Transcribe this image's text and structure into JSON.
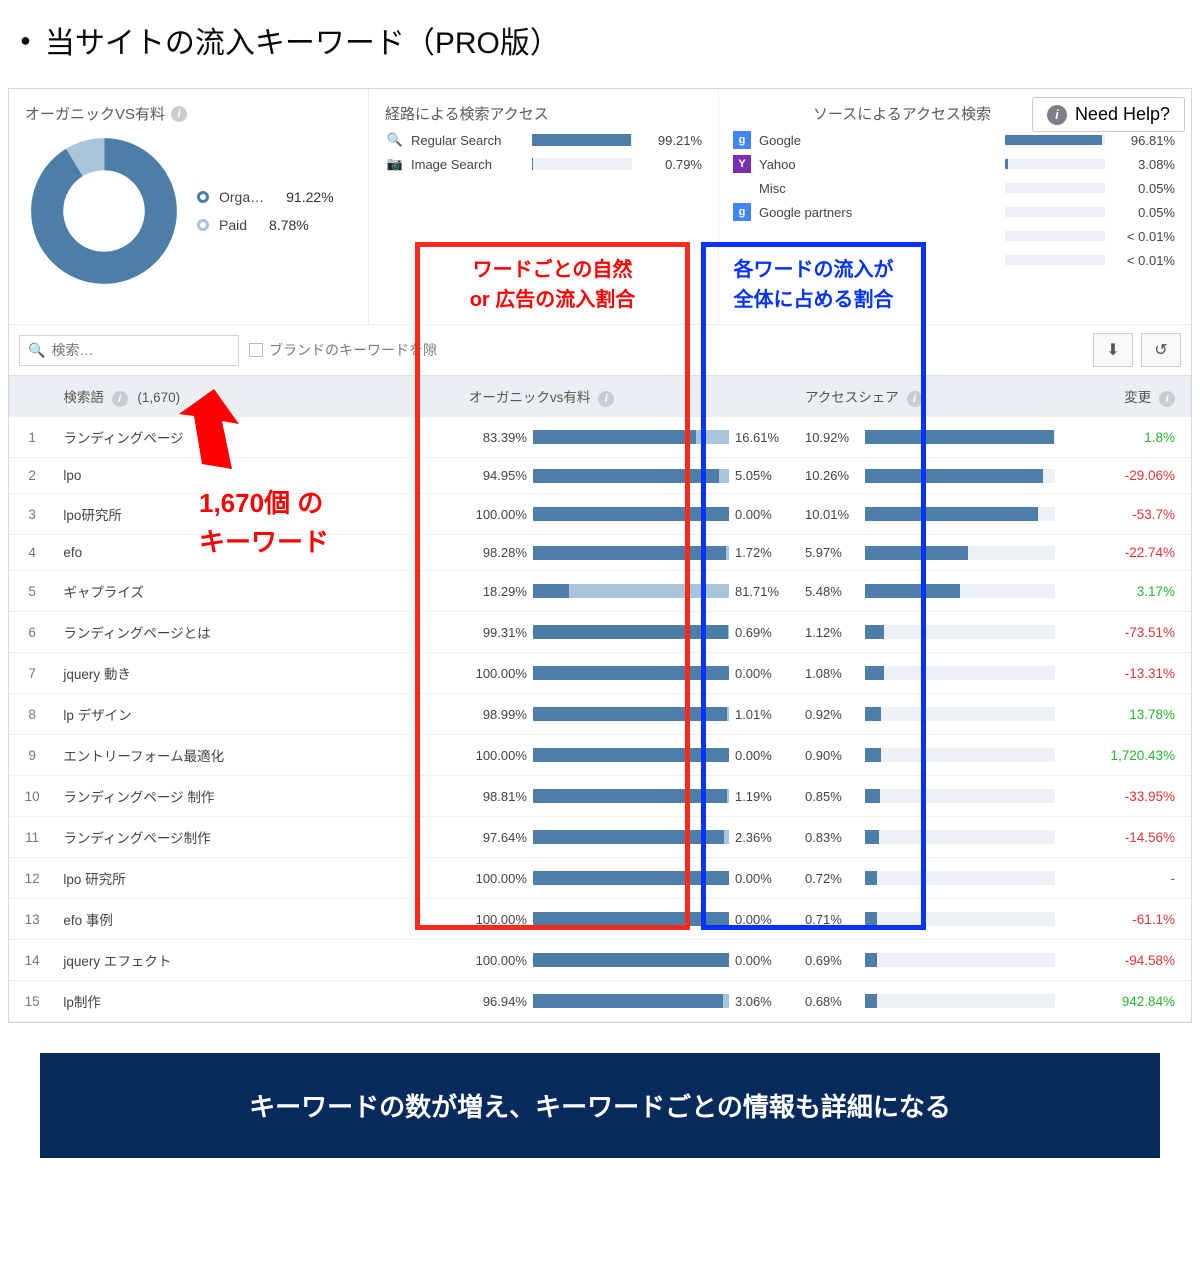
{
  "page_title": "当サイトの流入キーワード（PRO版）",
  "need_help": "Need Help?",
  "panels": {
    "organic_vs_paid": {
      "title": "オーガニックVS有料",
      "organic_label": "Orga…",
      "organic_pct": "91.22%",
      "organic_val": 91.22,
      "paid_label": "Paid",
      "paid_pct": "8.78%",
      "paid_val": 8.78,
      "colors": {
        "organic": "#4d7ea8",
        "paid": "#a8c5dc"
      }
    },
    "access_by_route": {
      "title": "経路による検索アクセス",
      "rows": [
        {
          "icon": "search-icon",
          "icon_glyph": "🔍",
          "label": "Regular Search",
          "pct": "99.21%",
          "val": 99.21
        },
        {
          "icon": "camera-icon",
          "icon_glyph": "📷",
          "label": "Image Search",
          "pct": "0.79%",
          "val": 0.79
        }
      ]
    },
    "access_by_source": {
      "title": "ソースによるアクセス検索",
      "rows": [
        {
          "icon": "google-icon",
          "icon_glyph": "g",
          "icon_bg": "#4285f4",
          "label": "Google",
          "pct": "96.81%",
          "val": 96.81
        },
        {
          "icon": "yahoo-icon",
          "icon_glyph": "Y",
          "icon_bg": "#7b2eb0",
          "label": "Yahoo",
          "pct": "3.08%",
          "val": 3.08
        },
        {
          "icon": "none",
          "icon_glyph": "",
          "icon_bg": "transparent",
          "label": "Misc",
          "pct": "0.05%",
          "val": 0.05
        },
        {
          "icon": "google-icon",
          "icon_glyph": "g",
          "icon_bg": "#4285f4",
          "label": "Google partners",
          "pct": "0.05%",
          "val": 0.05
        },
        {
          "icon": "none",
          "icon_glyph": "",
          "icon_bg": "transparent",
          "label": "",
          "pct": "< 0.01%",
          "val": 0.005
        },
        {
          "icon": "none",
          "icon_glyph": "",
          "icon_bg": "transparent",
          "label": "",
          "pct": "< 0.01%",
          "val": 0.005
        }
      ]
    }
  },
  "toolbar": {
    "search_placeholder": "検索…",
    "brand_checkbox_label": "ブランドのキーワードを隙"
  },
  "table": {
    "headers": {
      "keyword": "検索語",
      "keyword_count": "(1,670)",
      "ovs": "オーガニックvs有料",
      "share": "アクセスシェア",
      "change": "変更"
    },
    "rows": [
      {
        "idx": "1",
        "kw": "ランディングページ",
        "org": "83.39%",
        "orgv": 83.39,
        "paid": "16.61%",
        "share": "10.92%",
        "sharev": 10.92,
        "chg": "1.8%",
        "dir": "up"
      },
      {
        "idx": "2",
        "kw": "lpo",
        "org": "94.95%",
        "orgv": 94.95,
        "paid": "5.05%",
        "share": "10.26%",
        "sharev": 10.26,
        "chg": "-29.06%",
        "dir": "down"
      },
      {
        "idx": "3",
        "kw": "lpo研究所",
        "org": "100.00%",
        "orgv": 100,
        "paid": "0.00%",
        "share": "10.01%",
        "sharev": 10.01,
        "chg": "-53.7%",
        "dir": "down"
      },
      {
        "idx": "4",
        "kw": "efo",
        "org": "98.28%",
        "orgv": 98.28,
        "paid": "1.72%",
        "share": "5.97%",
        "sharev": 5.97,
        "chg": "-22.74%",
        "dir": "down"
      },
      {
        "idx": "5",
        "kw": "ギャプライズ",
        "org": "18.29%",
        "orgv": 18.29,
        "paid": "81.71%",
        "share": "5.48%",
        "sharev": 5.48,
        "chg": "3.17%",
        "dir": "up"
      },
      {
        "idx": "6",
        "kw": "ランディングページとは",
        "org": "99.31%",
        "orgv": 99.31,
        "paid": "0.69%",
        "share": "1.12%",
        "sharev": 1.12,
        "chg": "-73.51%",
        "dir": "down"
      },
      {
        "idx": "7",
        "kw": "jquery 動き",
        "org": "100.00%",
        "orgv": 100,
        "paid": "0.00%",
        "share": "1.08%",
        "sharev": 1.08,
        "chg": "-13.31%",
        "dir": "down"
      },
      {
        "idx": "8",
        "kw": "lp デザイン",
        "org": "98.99%",
        "orgv": 98.99,
        "paid": "1.01%",
        "share": "0.92%",
        "sharev": 0.92,
        "chg": "13.78%",
        "dir": "up"
      },
      {
        "idx": "9",
        "kw": "エントリーフォーム最適化",
        "org": "100.00%",
        "orgv": 100,
        "paid": "0.00%",
        "share": "0.90%",
        "sharev": 0.9,
        "chg": "1,720.43%",
        "dir": "up"
      },
      {
        "idx": "10",
        "kw": "ランディングページ 制作",
        "org": "98.81%",
        "orgv": 98.81,
        "paid": "1.19%",
        "share": "0.85%",
        "sharev": 0.85,
        "chg": "-33.95%",
        "dir": "down"
      },
      {
        "idx": "11",
        "kw": "ランディングページ制作",
        "org": "97.64%",
        "orgv": 97.64,
        "paid": "2.36%",
        "share": "0.83%",
        "sharev": 0.83,
        "chg": "-14.56%",
        "dir": "down"
      },
      {
        "idx": "12",
        "kw": "lpo 研究所",
        "org": "100.00%",
        "orgv": 100,
        "paid": "0.00%",
        "share": "0.72%",
        "sharev": 0.72,
        "chg": "-",
        "dir": "none"
      },
      {
        "idx": "13",
        "kw": "efo 事例",
        "org": "100.00%",
        "orgv": 100,
        "paid": "0.00%",
        "share": "0.71%",
        "sharev": 0.71,
        "chg": "-61.1%",
        "dir": "down"
      },
      {
        "idx": "14",
        "kw": "jquery エフェクト",
        "org": "100.00%",
        "orgv": 100,
        "paid": "0.00%",
        "share": "0.69%",
        "sharev": 0.69,
        "chg": "-94.58%",
        "dir": "down"
      },
      {
        "idx": "15",
        "kw": "lp制作",
        "org": "96.94%",
        "orgv": 96.94,
        "paid": "3.06%",
        "share": "0.68%",
        "sharev": 0.68,
        "chg": "942.84%",
        "dir": "up"
      }
    ]
  },
  "annotations": {
    "red_label_1": "ワードごとの自然",
    "red_label_2": "or 広告の流入割合",
    "blue_label_1": "各ワードの流入が",
    "blue_label_2": "全体に占める割合",
    "caption_1": "1,670個 の",
    "caption_2": "キーワード"
  },
  "banner": "キーワードの数が増え、キーワードごとの情報も詳細になる",
  "chart_data": [
    {
      "type": "pie",
      "title": "オーガニックVS有料",
      "series": [
        {
          "name": "Orga…",
          "value": 91.22
        },
        {
          "name": "Paid",
          "value": 8.78
        }
      ]
    },
    {
      "type": "bar",
      "title": "経路による検索アクセス",
      "categories": [
        "Regular Search",
        "Image Search"
      ],
      "values": [
        99.21,
        0.79
      ]
    },
    {
      "type": "bar",
      "title": "ソースによるアクセス検索",
      "categories": [
        "Google",
        "Yahoo",
        "Misc",
        "Google partners",
        "",
        ""
      ],
      "values": [
        96.81,
        3.08,
        0.05,
        0.05,
        0.005,
        0.005
      ]
    },
    {
      "type": "table",
      "title": "検索語 (1,670)",
      "columns": [
        "検索語",
        "オーガニック%",
        "有料%",
        "アクセスシェア%",
        "変更%"
      ],
      "rows": [
        [
          "ランディングページ",
          83.39,
          16.61,
          10.92,
          1.8
        ],
        [
          "lpo",
          94.95,
          5.05,
          10.26,
          -29.06
        ],
        [
          "lpo研究所",
          100.0,
          0.0,
          10.01,
          -53.7
        ],
        [
          "efo",
          98.28,
          1.72,
          5.97,
          -22.74
        ],
        [
          "ギャプライズ",
          18.29,
          81.71,
          5.48,
          3.17
        ],
        [
          "ランディングページとは",
          99.31,
          0.69,
          1.12,
          -73.51
        ],
        [
          "jquery 動き",
          100.0,
          0.0,
          1.08,
          -13.31
        ],
        [
          "lp デザイン",
          98.99,
          1.01,
          0.92,
          13.78
        ],
        [
          "エントリーフォーム最適化",
          100.0,
          0.0,
          0.9,
          1720.43
        ],
        [
          "ランディングページ 制作",
          98.81,
          1.19,
          0.85,
          -33.95
        ],
        [
          "ランディングページ制作",
          97.64,
          2.36,
          0.83,
          -14.56
        ],
        [
          "lpo 研究所",
          100.0,
          0.0,
          0.72,
          null
        ],
        [
          "efo 事例",
          100.0,
          0.0,
          0.71,
          -61.1
        ],
        [
          "jquery エフェクト",
          100.0,
          0.0,
          0.69,
          -94.58
        ],
        [
          "lp制作",
          96.94,
          3.06,
          0.68,
          942.84
        ]
      ]
    }
  ]
}
